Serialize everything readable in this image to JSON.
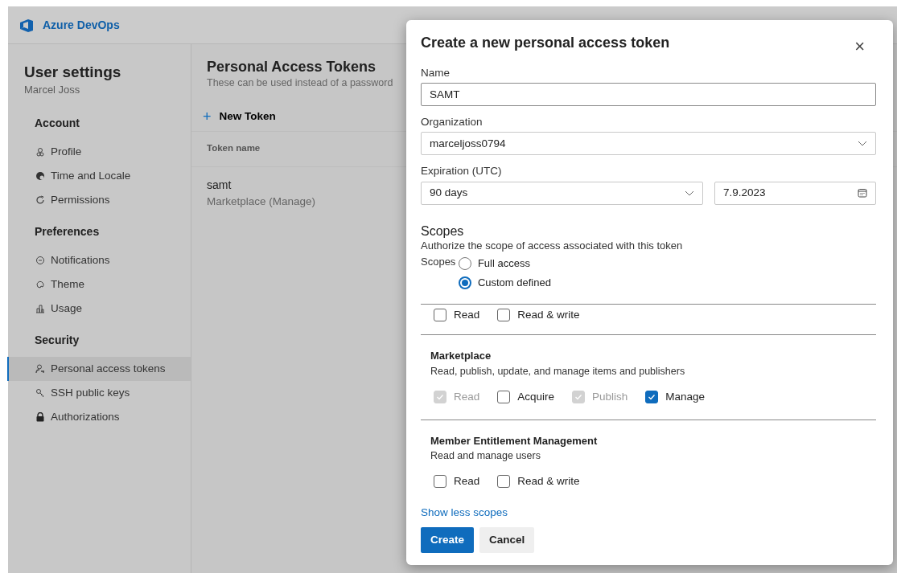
{
  "header": {
    "product": "Azure DevOps"
  },
  "sidebar": {
    "title": "User settings",
    "user": "Marcel Joss",
    "sections": [
      {
        "heading": "Account",
        "items": [
          {
            "label": "Profile",
            "selected": false
          },
          {
            "label": "Time and Locale",
            "selected": false
          },
          {
            "label": "Permissions",
            "selected": false
          }
        ]
      },
      {
        "heading": "Preferences",
        "items": [
          {
            "label": "Notifications",
            "selected": false
          },
          {
            "label": "Theme",
            "selected": false
          },
          {
            "label": "Usage",
            "selected": false
          }
        ]
      },
      {
        "heading": "Security",
        "items": [
          {
            "label": "Personal access tokens",
            "selected": true
          },
          {
            "label": "SSH public keys",
            "selected": false
          },
          {
            "label": "Authorizations",
            "selected": false
          }
        ]
      }
    ]
  },
  "main": {
    "title": "Personal Access Tokens",
    "subtitle": "These can be used instead of a password",
    "new_button": "New Token",
    "plus": "+",
    "columns": [
      "Token name"
    ],
    "rows": [
      {
        "name": "samt",
        "scope": "Marketplace (Manage)"
      }
    ]
  },
  "dialog": {
    "title": "Create a new personal access token",
    "close": "×",
    "fields": [
      {
        "label": "Name",
        "kind": "text",
        "value": "SAMT"
      },
      {
        "label": "Organization",
        "kind": "select",
        "value": "marceljoss0794"
      }
    ],
    "expiration": {
      "label": "Expiration (UTC)",
      "period": "90 days",
      "date": "7.9.2023"
    },
    "scopes_title": "Scopes",
    "scopes_text": "Authorize the scope of access associated with this token",
    "scopes_label": "Scopes",
    "radios": [
      {
        "label": "Full access",
        "selected": false
      },
      {
        "label": "Custom defined",
        "selected": true
      }
    ],
    "scopes": [
      {
        "options": [
          {
            "label": "Read",
            "checked": false,
            "disabled": false
          },
          {
            "label": "Read & write",
            "checked": false,
            "disabled": false
          }
        ]
      },
      {
        "title": "Marketplace",
        "description": "Read, publish, update, and manage items and publishers",
        "options": [
          {
            "label": "Read",
            "checked": true,
            "disabled": true
          },
          {
            "label": "Acquire",
            "checked": false,
            "disabled": false
          },
          {
            "label": "Publish",
            "checked": true,
            "disabled": true
          },
          {
            "label": "Manage",
            "checked": true,
            "disabled": false
          }
        ]
      },
      {
        "title": "Member Entitlement Management",
        "description": "Read and manage users",
        "options": [
          {
            "label": "Read",
            "checked": false,
            "disabled": false
          },
          {
            "label": "Read & write",
            "checked": false,
            "disabled": false
          }
        ]
      }
    ],
    "toggle_link": "Show less scopes",
    "buttons": [
      {
        "label": "Create",
        "kind": "primary"
      },
      {
        "label": "Cancel",
        "kind": "secondary"
      }
    ]
  }
}
